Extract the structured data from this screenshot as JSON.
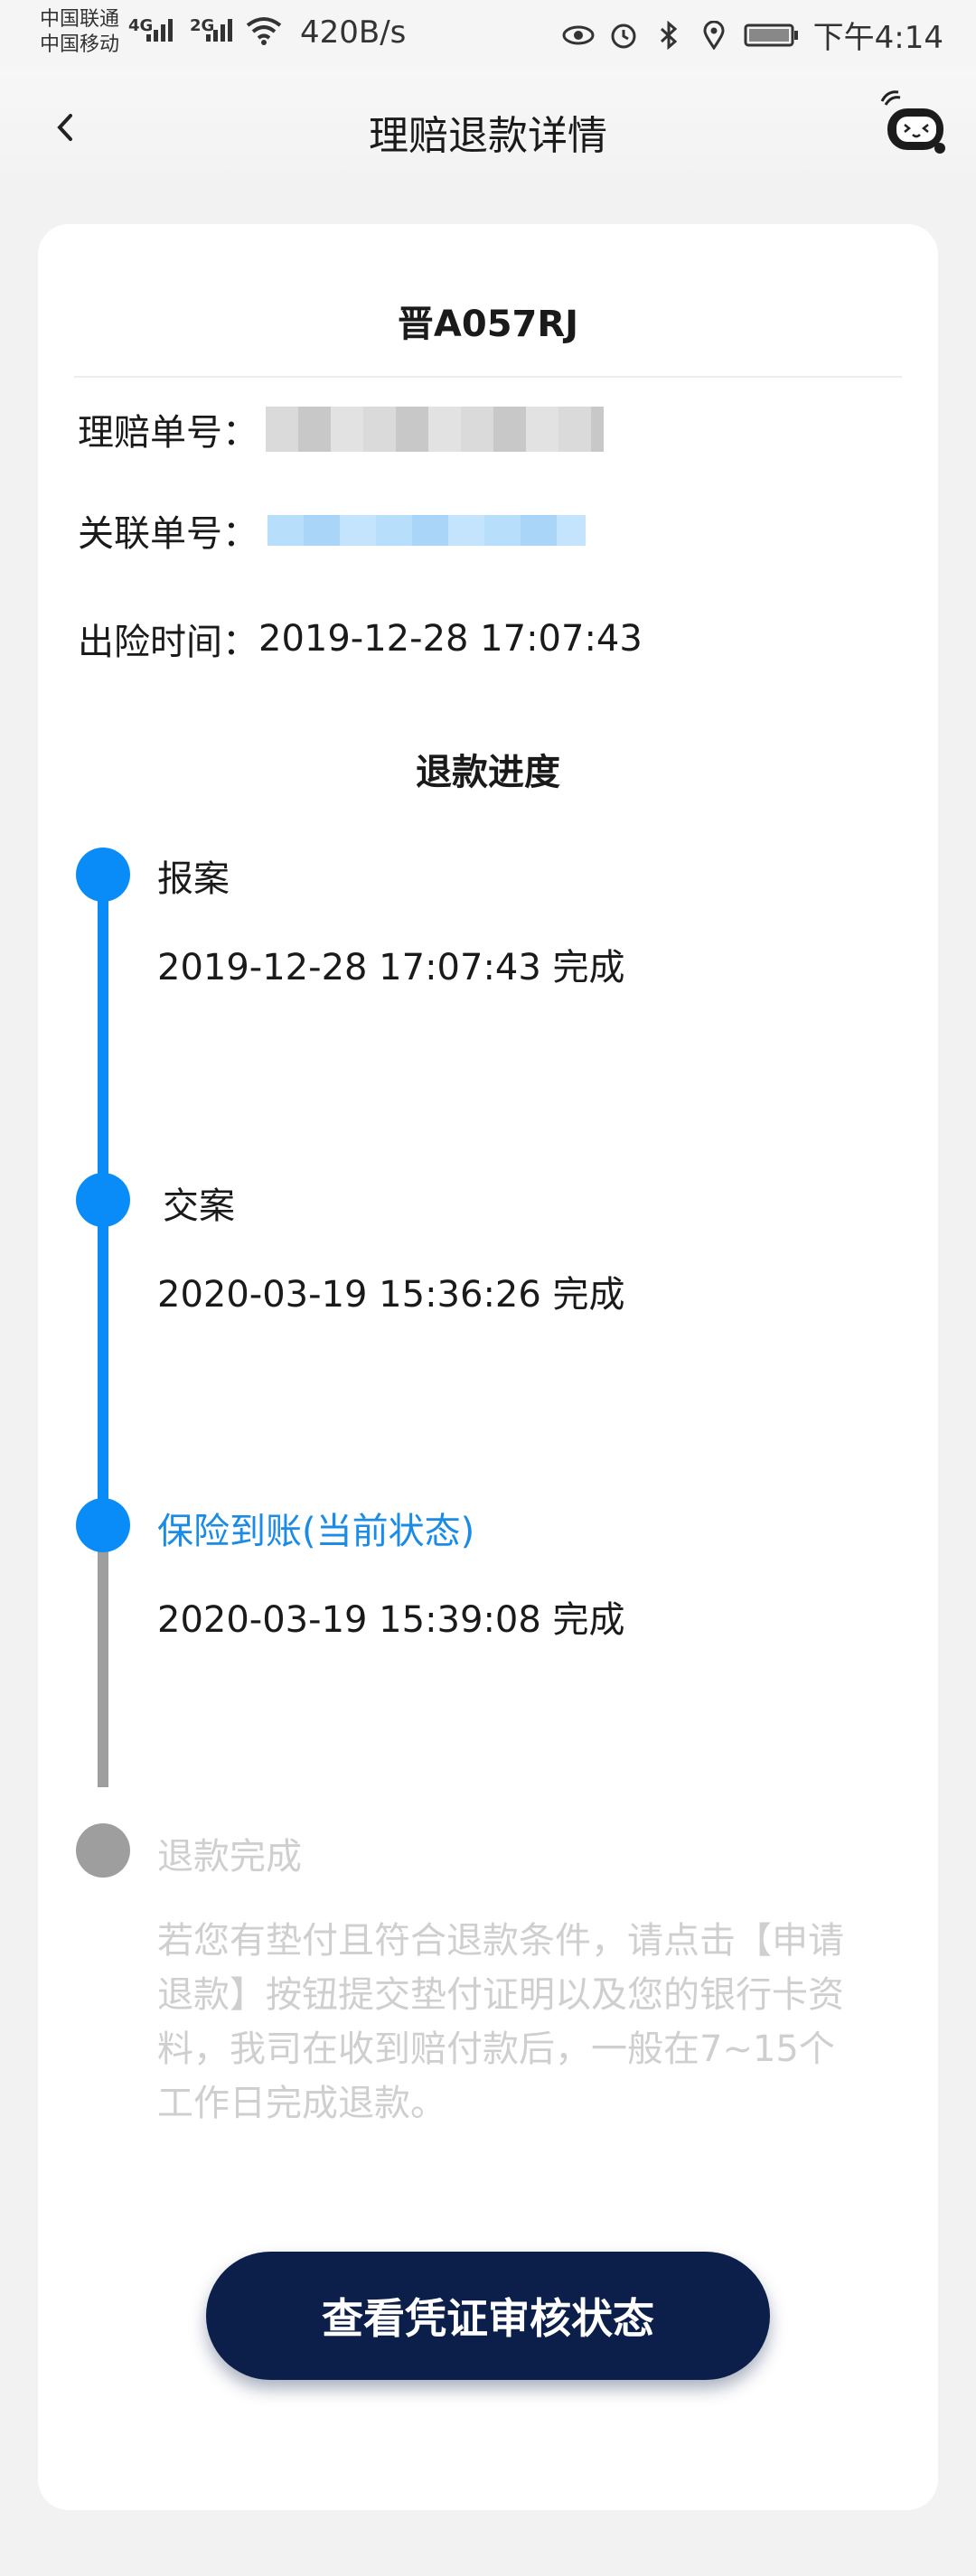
{
  "status_bar": {
    "carrier1": "中国联通",
    "carrier2": "中国移动",
    "net1": "4G",
    "net2": "2G",
    "speed": "420B/s",
    "time": "下午4:14",
    "icons": [
      "eye-icon",
      "alarm-icon",
      "bluetooth-icon",
      "location-icon",
      "battery-icon"
    ]
  },
  "header": {
    "title": "理赔退款详情",
    "back_icon": "back-arrow-icon",
    "service_icon": "customer-service-icon"
  },
  "claim": {
    "plate": "晋A057RJ",
    "claim_no_label": "理赔单号：",
    "related_no_label": "关联单号：",
    "incident_label": "出险时间：",
    "incident_time": "2019-12-28 17:07:43"
  },
  "progress": {
    "title": "退款进度",
    "steps": [
      {
        "label": "报案",
        "time": "2019-12-28 17:07:43 完成"
      },
      {
        "label": "交案",
        "time": "2020-03-19 15:36:26 完成"
      },
      {
        "label": "保险到账(当前状态)",
        "time": "2020-03-19 15:39:08 完成"
      },
      {
        "label": "退款完成",
        "time": ""
      }
    ],
    "note": "若您有垫付且符合退款条件，请点击【申请退款】按钮提交垫付证明以及您的银行卡资料，我司在收到赔付款后，一般在7~15个工作日完成退款。",
    "colors": {
      "active": "#0a8cf8",
      "inactive": "#9e9e9e",
      "current_text": "#1a8be6",
      "pending_text": "#cfcfcf"
    }
  },
  "actions": {
    "view_button": "查看凭证审核状态"
  }
}
